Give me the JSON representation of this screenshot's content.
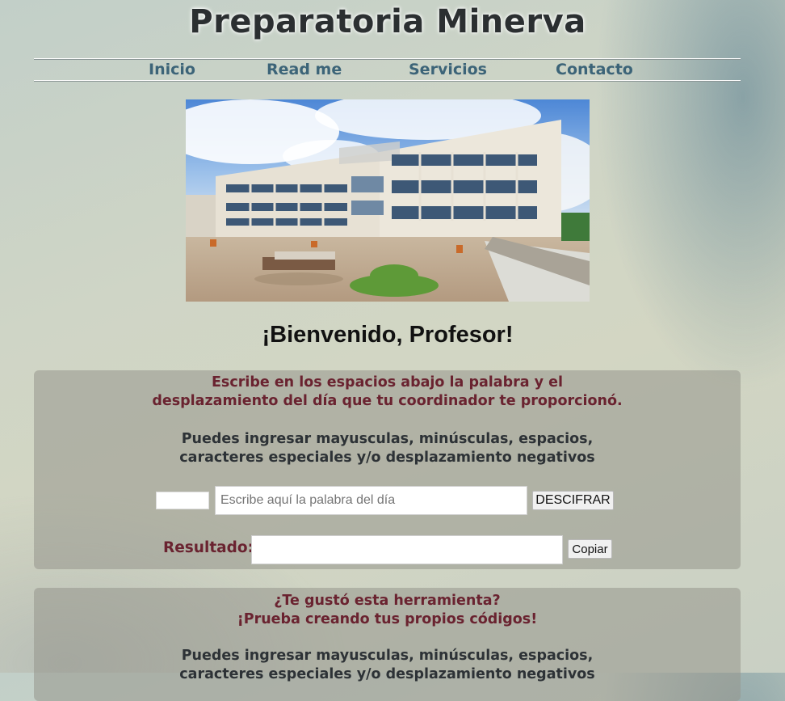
{
  "site": {
    "title": "Preparatoria Minerva"
  },
  "nav": {
    "items": [
      {
        "label": "Inicio"
      },
      {
        "label": "Read me"
      },
      {
        "label": "Servicios"
      },
      {
        "label": "Contacto"
      }
    ]
  },
  "hero": {
    "image_description_icon": "school-building-photo"
  },
  "welcome": "¡Bienvenido, Profesor!",
  "decipher_panel": {
    "instruction_line1": "Escribe en los espacios abajo la palabra y el",
    "instruction_line2": "desplazamiento del día que tu coordinador te proporcionó.",
    "note_line1": "Puedes ingresar mayusculas, minúsculas, espacios,",
    "note_line2": "caracteres especiales y/o desplazamiento negativos",
    "shift_value": "",
    "word_placeholder": "Escribe aquí la palabra del día",
    "decipher_button": "DESCIFRAR",
    "result_label": "Resultado:",
    "result_value": "",
    "copy_button": "Copiar"
  },
  "create_panel": {
    "heading_line1": "¿Te gustó esta herramienta?",
    "heading_line2": "¡Prueba creando tus propios códigos!",
    "note_line1": "Puedes ingresar mayusculas, minúsculas, espacios,",
    "note_line2": "caracteres especiales y/o desplazamiento negativos"
  },
  "colors": {
    "nav_link": "#3c6478",
    "accent_maroon": "#6a2330",
    "panel_bg": "#969690"
  }
}
